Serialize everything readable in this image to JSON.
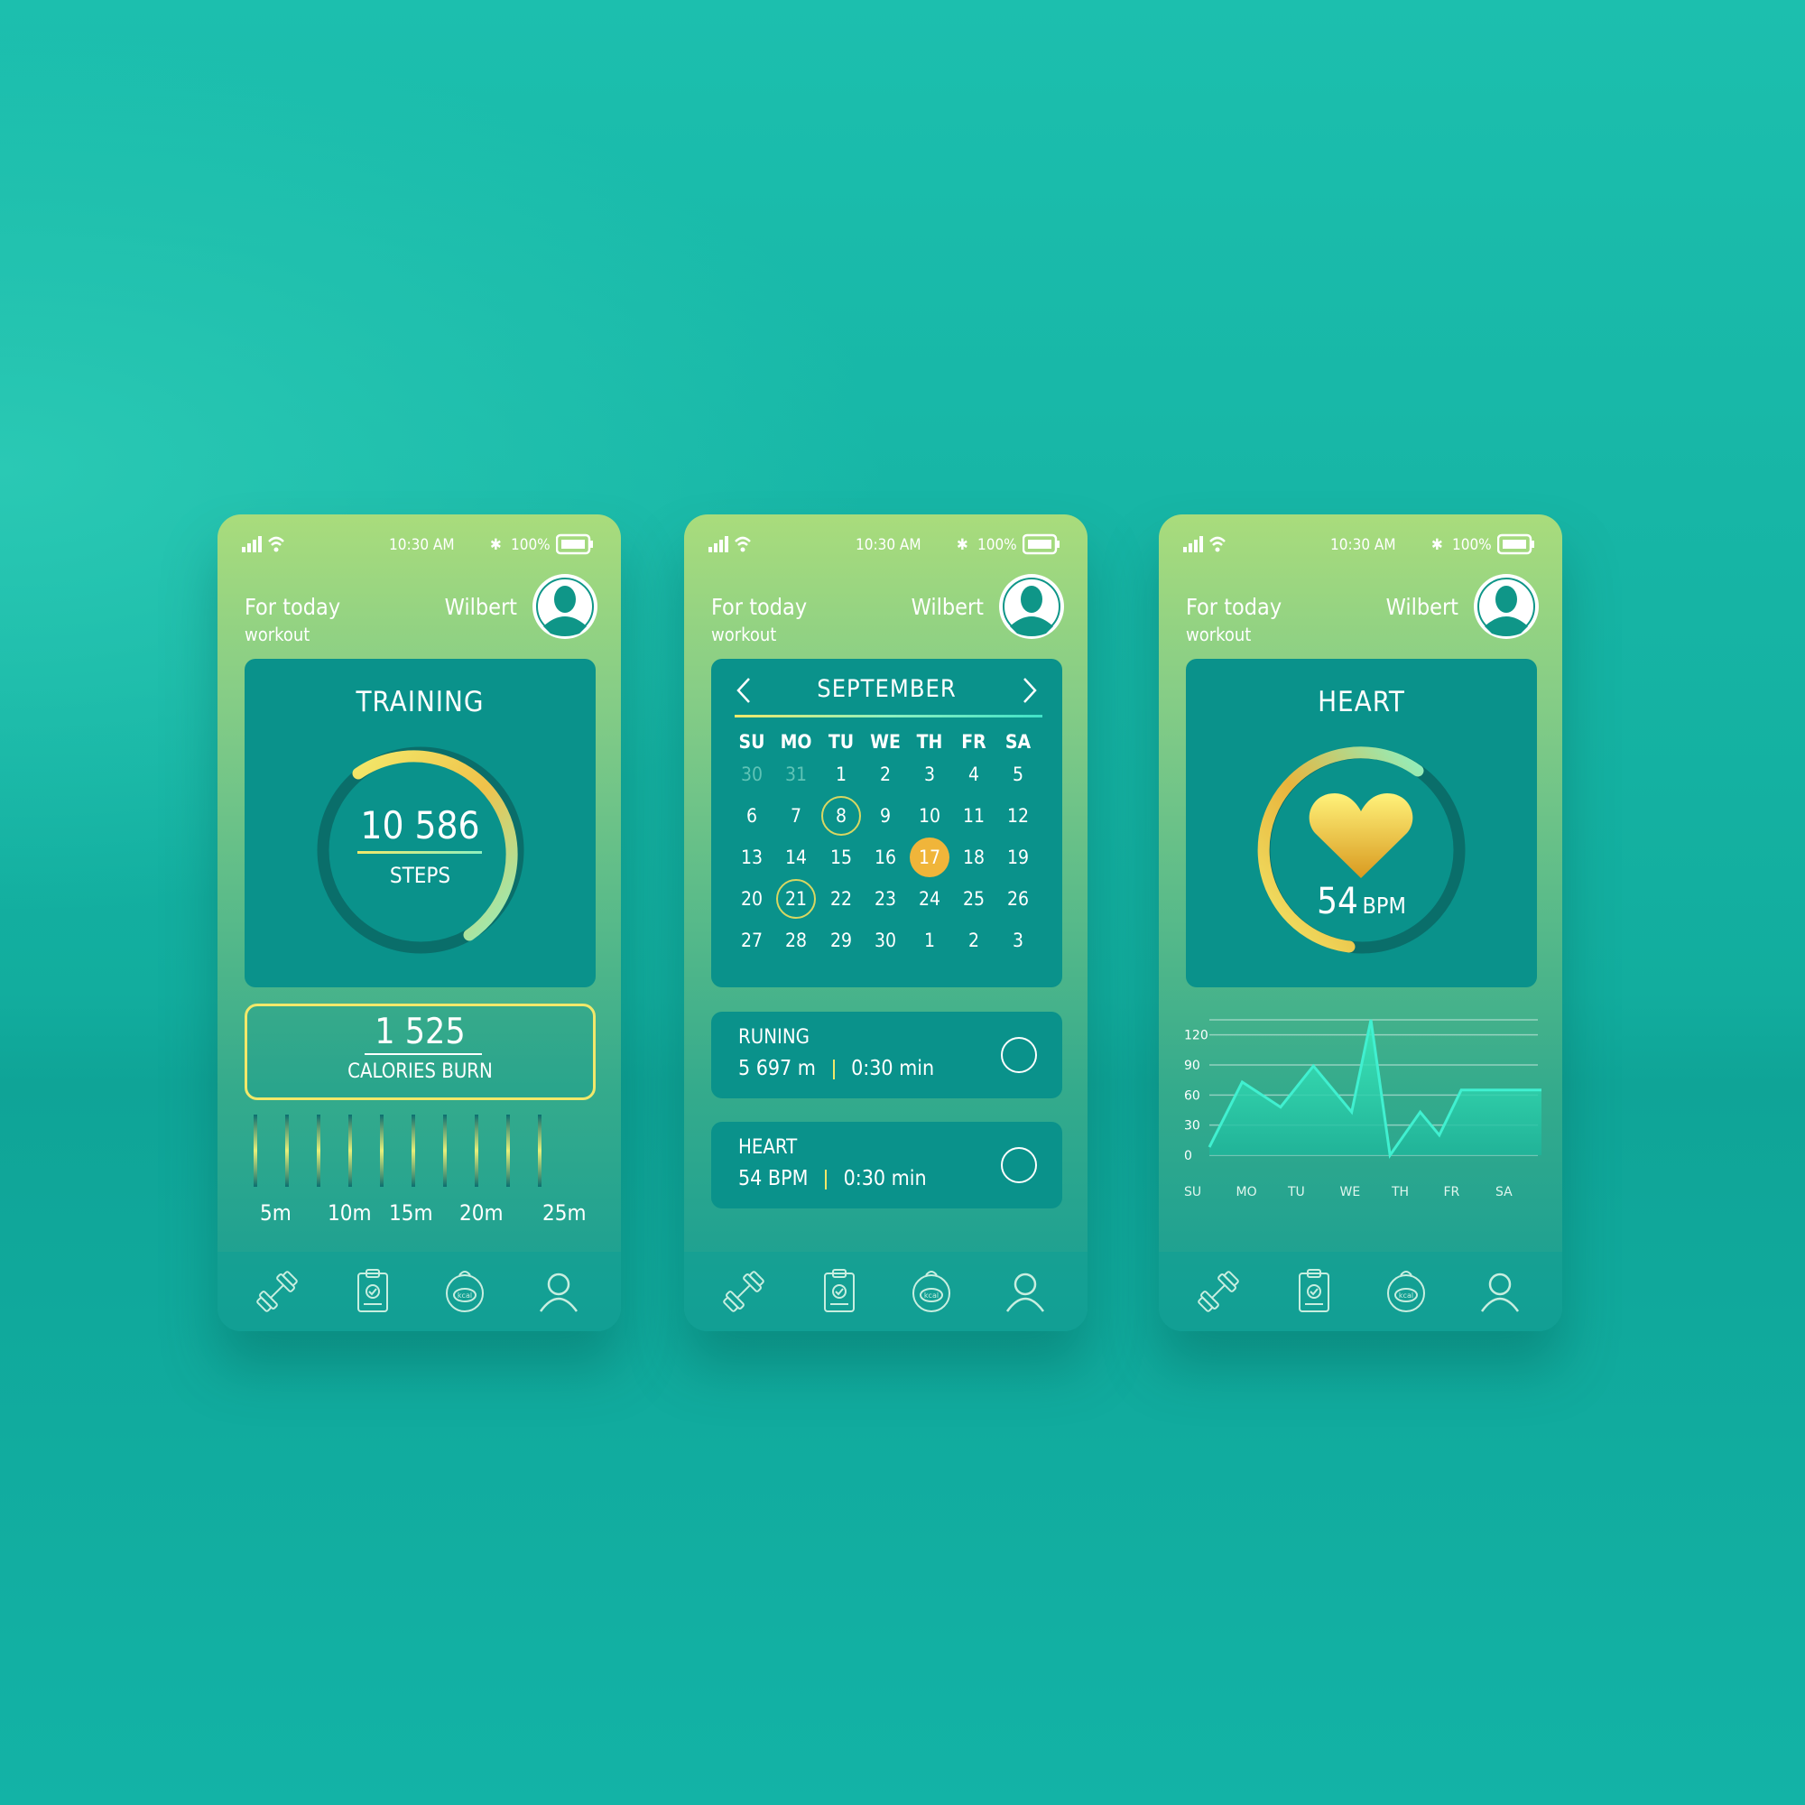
{
  "status": {
    "time": "10:30 AM",
    "battery": "100%"
  },
  "header": {
    "title": "For today",
    "subtitle": "workout",
    "user": "Wilbert"
  },
  "training": {
    "title": "TRAINING",
    "steps_value": "10 586",
    "steps_label": "STEPS",
    "calories_value": "1 525",
    "calories_label": "CALORIES BURN",
    "timeline": [
      "5m",
      "10m",
      "15m",
      "20m",
      "25m"
    ]
  },
  "calendar": {
    "month": "SEPTEMBER",
    "day_names": [
      "SU",
      "MO",
      "TU",
      "WE",
      "TH",
      "FR",
      "SA"
    ],
    "weeks": [
      [
        "30",
        "31",
        "1",
        "2",
        "3",
        "4",
        "5"
      ],
      [
        "6",
        "7",
        "8",
        "9",
        "10",
        "11",
        "12"
      ],
      [
        "13",
        "14",
        "15",
        "16",
        "17",
        "18",
        "19"
      ],
      [
        "20",
        "21",
        "22",
        "23",
        "24",
        "25",
        "26"
      ],
      [
        "27",
        "28",
        "29",
        "30",
        "1",
        "2",
        "3"
      ]
    ],
    "selected_days": [
      "8",
      "21"
    ],
    "today": "17"
  },
  "activities": [
    {
      "name": "RUNING",
      "value1": "5 697 m",
      "value2": "0:30 min"
    },
    {
      "name": "HEART",
      "value1": "54 BPM",
      "value2": "0:30 min"
    }
  ],
  "heart": {
    "title": "HEART",
    "bpm_value": "54",
    "bpm_unit": "BPM"
  },
  "chart_data": {
    "type": "area",
    "title": "",
    "xlabel": "",
    "ylabel": "",
    "categories": [
      "SU",
      "MO",
      "TU",
      "WE",
      "TH",
      "FR",
      "SA"
    ],
    "yticks": [
      "120",
      "90",
      "60",
      "30",
      "0"
    ],
    "ylim": [
      0,
      135
    ],
    "x": [
      0,
      0.6,
      1.3,
      1.9,
      2.6,
      2.95,
      3.3,
      3.85,
      4.2,
      4.6,
      4.85,
      5.4,
      6.2
    ],
    "values": [
      8,
      73,
      48,
      89,
      43,
      135,
      0,
      43,
      20,
      65,
      65,
      65,
      65
    ],
    "grid": true,
    "colors": {
      "line": "#40f0d0",
      "fill": "#2fe0b5"
    }
  },
  "colors": {
    "card": "#0a928b",
    "accent_yellow": "#f2e86a",
    "accent_green": "#8ff0c0",
    "today": "#f0b53a"
  }
}
